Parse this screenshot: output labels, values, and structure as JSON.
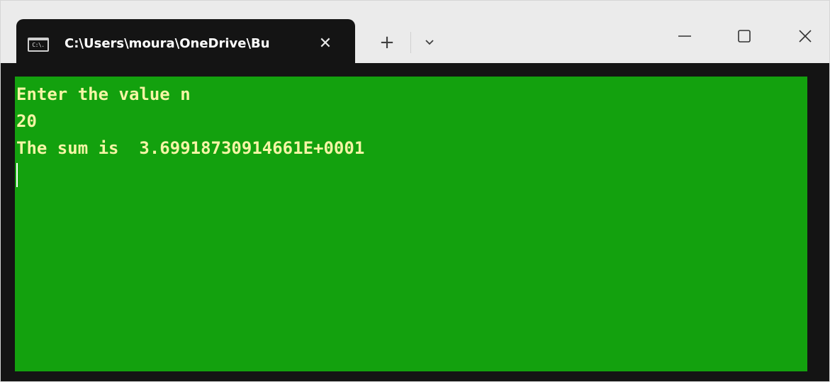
{
  "tab": {
    "icon": "terminal-icon",
    "icon_text": "C:\\.",
    "title": "C:\\Users\\moura\\OneDrive\\Bu",
    "close_glyph": "✕"
  },
  "toolbar": {
    "new_tab_glyph": "+",
    "dropdown_icon": "chevron-down-icon"
  },
  "window_controls": {
    "minimize_icon": "minimize-icon",
    "maximize_icon": "maximize-icon",
    "close_icon": "close-icon"
  },
  "console": {
    "lines": [
      "Enter the value n",
      "20",
      "The sum is  3.69918730914661E+0001"
    ]
  },
  "colors": {
    "terminal_background": "#13a10e",
    "terminal_text": "#f5f5a5",
    "titlebar": "#ebebeb",
    "tab_background": "#141414"
  }
}
